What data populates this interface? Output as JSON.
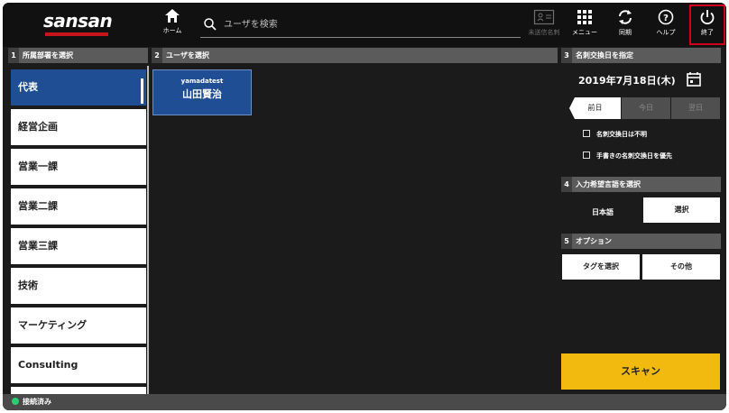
{
  "header": {
    "logo": "sansan",
    "home_label": "ホーム",
    "search_placeholder": "ユーザを検索",
    "unreceived_label": "未送信名刺",
    "menu_label": "メニュー",
    "sync_label": "同期",
    "help_label": "ヘルプ",
    "exit_label": "終了"
  },
  "departments": {
    "title": "所属部署を選択",
    "num": "1",
    "items": [
      {
        "label": "代表",
        "selected": true
      },
      {
        "label": "経営企画",
        "selected": false
      },
      {
        "label": "営業一課",
        "selected": false
      },
      {
        "label": "営業二課",
        "selected": false
      },
      {
        "label": "営業三課",
        "selected": false
      },
      {
        "label": "技術",
        "selected": false
      },
      {
        "label": "マーケティング",
        "selected": false
      },
      {
        "label": "Consulting",
        "selected": false
      }
    ]
  },
  "users": {
    "title": "ユーザを選択",
    "num": "2",
    "items": [
      {
        "id": "yamadatest",
        "name": "山田賢治"
      }
    ]
  },
  "date_section": {
    "title": "名刺交換日を指定",
    "num": "3",
    "date": "2019年7月18日(木)",
    "buttons": [
      "前日",
      "今日",
      "翌日"
    ],
    "check_unknown": "名刺交換日は不明",
    "check_handwritten": "手書きの名刺交換日を優先"
  },
  "language_section": {
    "title": "入力希望言語を選択",
    "num": "4",
    "current": "日本語",
    "select_button": "選択"
  },
  "option_section": {
    "title": "オプション",
    "num": "5",
    "tag_button": "タグを選択",
    "other_button": "その他"
  },
  "scan_button": "スキャン",
  "status": {
    "text": "接続済み",
    "color": "#2ecc71"
  },
  "colors": {
    "selected": "#1f4e94",
    "scan": "#f2b90f",
    "logo_accent": "#c8141b",
    "highlight": "#d0021b"
  }
}
